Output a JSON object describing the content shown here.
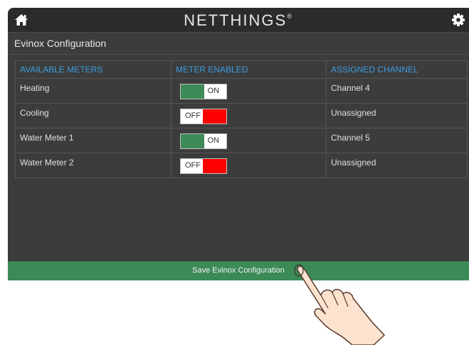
{
  "header": {
    "logo_text": "NETTHINGS",
    "logo_mark": "®",
    "home_icon": "home-icon",
    "settings_icon": "gear-icon"
  },
  "section": {
    "title": "Evinox Configuration"
  },
  "table": {
    "columns": [
      "AVAILABLE METERS",
      "METER ENABLED",
      "ASSIGNED CHANNEL"
    ],
    "rows": [
      {
        "meter": "Heating",
        "enabled": true,
        "toggle_label": "ON",
        "channel": "Channel 4"
      },
      {
        "meter": "Cooling",
        "enabled": false,
        "toggle_label": "OFF",
        "channel": "Unassigned"
      },
      {
        "meter": "Water Meter 1",
        "enabled": true,
        "toggle_label": "ON",
        "channel": "Channel 5"
      },
      {
        "meter": "Water Meter 2",
        "enabled": false,
        "toggle_label": "OFF",
        "channel": "Unassigned"
      }
    ]
  },
  "save_button": {
    "label": "Save Evinox Configuration"
  },
  "colors": {
    "accent_blue": "#3d9de0",
    "on_green": "#3e8a58",
    "off_red": "#ff0000",
    "save_green": "#3c8a56",
    "panel_bg": "#3c3c3c"
  }
}
